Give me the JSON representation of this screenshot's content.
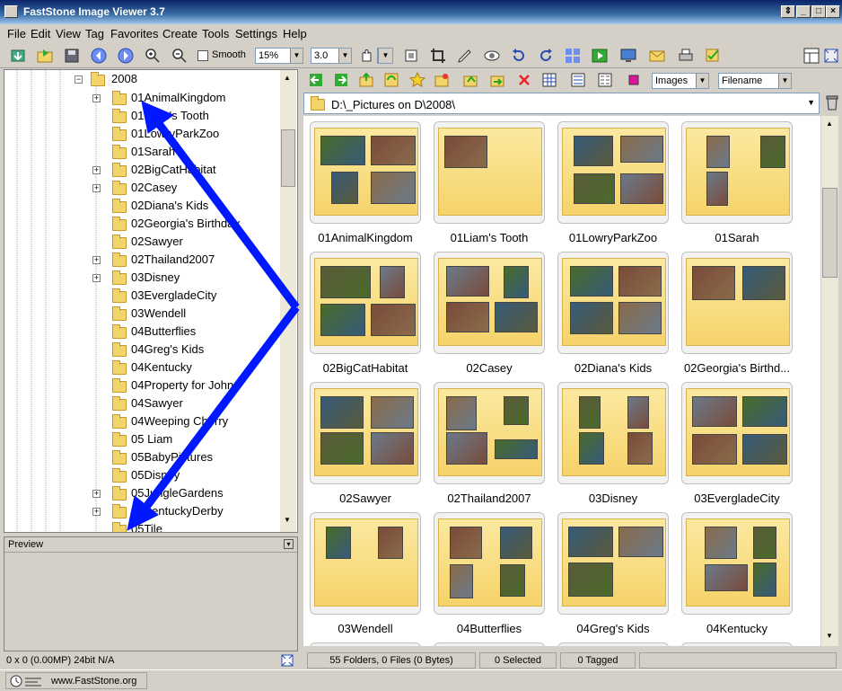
{
  "window": {
    "title": "FastStone Image Viewer 3.7"
  },
  "menu": [
    "File",
    "Edit",
    "View",
    "Tag",
    "Favorites",
    "Create",
    "Tools",
    "Settings",
    "Help"
  ],
  "toolbar": {
    "smooth_label": "Smooth",
    "zoom_value": "15%",
    "zoom_step": "3.0",
    "filter_value": "Images",
    "sort_value": "Filename"
  },
  "tree": {
    "root": "2008",
    "items": [
      "01AnimalKingdom",
      "01Liam's Tooth",
      "01LowryParkZoo",
      "01Sarah",
      "02BigCatHabitat",
      "02Casey",
      "02Diana's Kids",
      "02Georgia's Birthday",
      "02Sawyer",
      "02Thailand2007",
      "03Disney",
      "03EvergladeCity",
      "03Wendell",
      "04Butterflies",
      "04Greg's Kids",
      "04Kentucky",
      "04Property for John",
      "04Sawyer",
      "04Weeping Cherry",
      "05 Liam",
      "05BabyPictures",
      "05Disney",
      "05JungleGardens",
      "05KentuckyDerby",
      "05Tile"
    ],
    "expandable": [
      true,
      false,
      false,
      false,
      true,
      true,
      false,
      false,
      false,
      true,
      true,
      false,
      false,
      false,
      false,
      false,
      false,
      false,
      false,
      false,
      false,
      false,
      true,
      true,
      false
    ]
  },
  "preview": {
    "header": "Preview"
  },
  "left_status": "0 x 0 (0.00MP)   24bit N/A",
  "path": "D:\\_Pictures on D\\2008\\",
  "thumbnails": [
    "01AnimalKingdom",
    "01Liam's Tooth",
    "01LowryParkZoo",
    "01Sarah",
    "02BigCatHabitat",
    "02Casey",
    "02Diana's Kids",
    "02Georgia's Birthd...",
    "02Sawyer",
    "02Thailand2007",
    "03Disney",
    "03EvergladeCity",
    "03Wendell",
    "04Butterflies",
    "04Greg's Kids",
    "04Kentucky"
  ],
  "status": {
    "folders_files": "55 Folders, 0 Files (0 Bytes)",
    "selected": "0 Selected",
    "tagged": "0 Tagged"
  },
  "bottom": {
    "website": "www.FastStone.org"
  },
  "colors": {
    "arrow": "#0018ff",
    "folder": "#f6d36a",
    "titlebar": "#0a246a"
  }
}
